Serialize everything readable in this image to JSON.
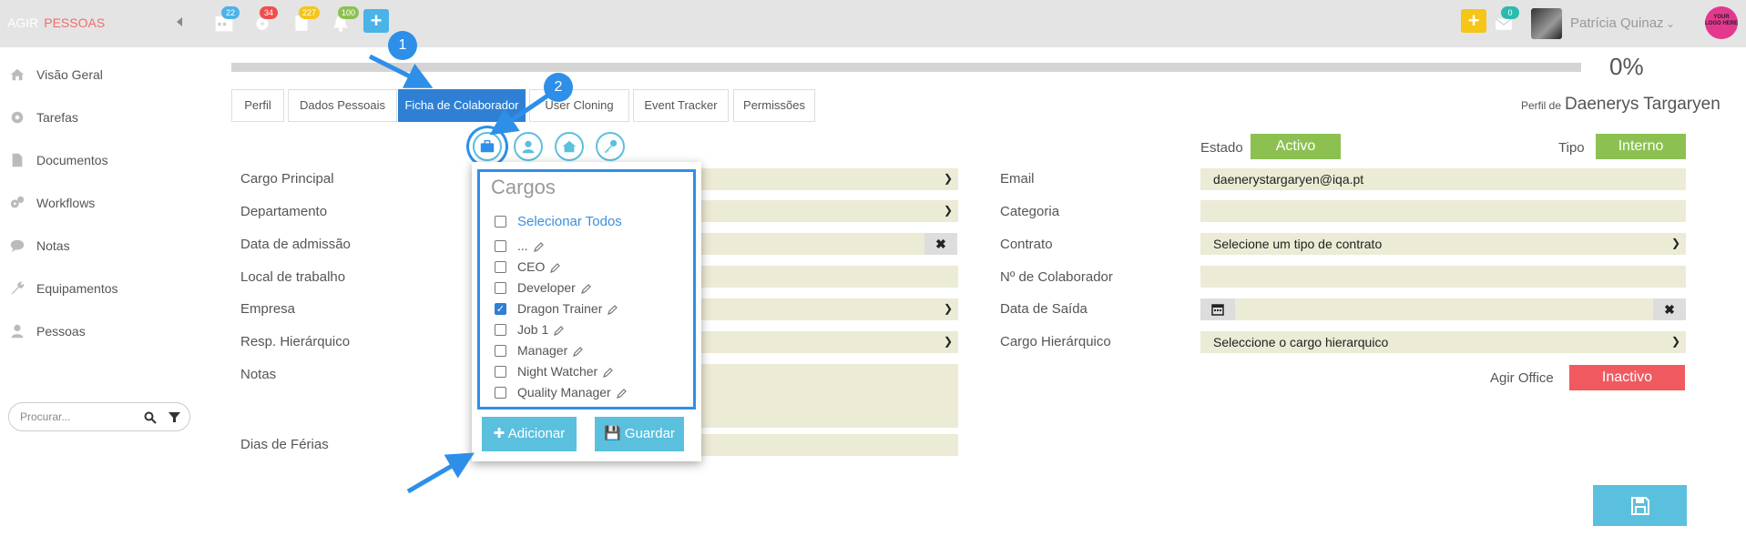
{
  "brand": {
    "part1": "AGIR",
    "part2": "PESSOAS"
  },
  "topbar": {
    "badges": {
      "calendar": "22",
      "settings": "34",
      "docs": "227",
      "bell": "100",
      "mail": "0"
    },
    "user_name": "Patrícia Quinaz",
    "logo_text": "YOUR LOGO HERE"
  },
  "sidebar": {
    "items": [
      {
        "label": "Visão Geral",
        "icon": "home-icon"
      },
      {
        "label": "Tarefas",
        "icon": "gear-icon"
      },
      {
        "label": "Documentos",
        "icon": "document-icon"
      },
      {
        "label": "Workflows",
        "icon": "gears-icon"
      },
      {
        "label": "Notas",
        "icon": "chat-icon"
      },
      {
        "label": "Equipamentos",
        "icon": "wrench-icon"
      },
      {
        "label": "Pessoas",
        "icon": "person-icon"
      }
    ],
    "search_placeholder": "Procurar..."
  },
  "progress": {
    "value": 0,
    "label": "0%"
  },
  "tabs": [
    {
      "label": "Perfil"
    },
    {
      "label": "Dados Pessoais"
    },
    {
      "label": "Ficha de Colaborador"
    },
    {
      "label": "User Cloning"
    },
    {
      "label": "Event Tracker"
    },
    {
      "label": "Permissões"
    }
  ],
  "profile": {
    "prefix": "Perfil de",
    "name": "Daenerys Targaryen"
  },
  "estado": {
    "label": "Estado",
    "value": "Activo"
  },
  "tipo": {
    "label": "Tipo",
    "value": "Interno"
  },
  "left_fields": {
    "cargo": "Cargo Principal",
    "departamento": "Departamento",
    "admissao": "Data de admissão",
    "local": "Local de trabalho",
    "empresa": "Empresa",
    "resp": "Resp. Hierárquico",
    "notas": "Notas",
    "ferias": "Dias de Férias"
  },
  "right_fields": {
    "email_label": "Email",
    "email_value": "daenerystargaryen@iqa.pt",
    "categoria": "Categoria",
    "contrato_label": "Contrato",
    "contrato_value": "Selecione um tipo de contrato",
    "num_colab": "Nº de Colaborador",
    "saida": "Data de Saída",
    "cargo_hier_label": "Cargo Hierárquico",
    "cargo_hier_value": "Seleccione o cargo hierarquico"
  },
  "agir_office": {
    "label": "Agir Office",
    "value": "Inactivo"
  },
  "popup": {
    "title": "Cargos",
    "select_all": "Selecionar Todos",
    "items": [
      {
        "label": "...",
        "checked": false
      },
      {
        "label": "CEO",
        "checked": false
      },
      {
        "label": "Developer",
        "checked": false
      },
      {
        "label": "Dragon Trainer",
        "checked": true
      },
      {
        "label": "Job 1",
        "checked": false
      },
      {
        "label": "Manager",
        "checked": false
      },
      {
        "label": "Night Watcher",
        "checked": false
      },
      {
        "label": "Quality Manager",
        "checked": false
      }
    ],
    "add_label": "Adicionar",
    "save_label": "Guardar"
  },
  "markers": {
    "m1": "1",
    "m2": "2"
  },
  "colors": {
    "active_tab": "#2f80d5",
    "green": "#8cc152",
    "red": "#f05a5f",
    "cyan": "#5bc0de",
    "field": "#ecebd5"
  }
}
